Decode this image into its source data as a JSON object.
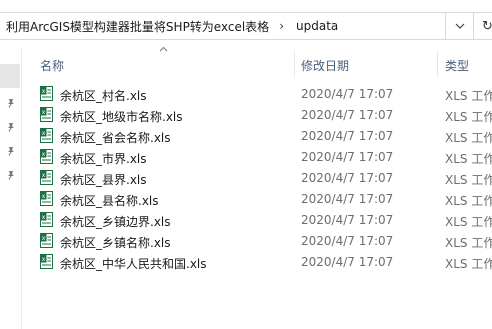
{
  "address": {
    "path": "利用ArcGIS模型构建器批量将SHP转为excel表格",
    "separator": "›",
    "current": "updata",
    "refresh_glyph": "↻"
  },
  "columns": {
    "name": "名称",
    "date": "修改日期",
    "type": "类型"
  },
  "files": [
    {
      "name": "余杭区_村名.xls",
      "date": "2020/4/7 17:07",
      "type": "XLS 工作"
    },
    {
      "name": "余杭区_地级市名称.xls",
      "date": "2020/4/7 17:07",
      "type": "XLS 工作"
    },
    {
      "name": "余杭区_省会名称.xls",
      "date": "2020/4/7 17:07",
      "type": "XLS 工作"
    },
    {
      "name": "余杭区_市界.xls",
      "date": "2020/4/7 17:07",
      "type": "XLS 工作"
    },
    {
      "name": "余杭区_县界.xls",
      "date": "2020/4/7 17:07",
      "type": "XLS 工作"
    },
    {
      "name": "余杭区_县名称.xls",
      "date": "2020/4/7 17:07",
      "type": "XLS 工作"
    },
    {
      "name": "余杭区_乡镇边界.xls",
      "date": "2020/4/7 17:07",
      "type": "XLS 工作"
    },
    {
      "name": "余杭区_乡镇名称.xls",
      "date": "2020/4/7 17:07",
      "type": "XLS 工作"
    },
    {
      "name": "余杭区_中华人民共和国.xls",
      "date": "2020/4/7 17:07",
      "type": "XLS 工作"
    }
  ],
  "icons": {
    "file": "excel-file-icon",
    "pin": "pin-icon",
    "dropdown": "chevron-down-icon",
    "sort": "sort-caret-icon"
  },
  "colors": {
    "excel_green": "#1d7044",
    "header_text": "#4c607a",
    "meta_text": "#6d6d6d"
  }
}
